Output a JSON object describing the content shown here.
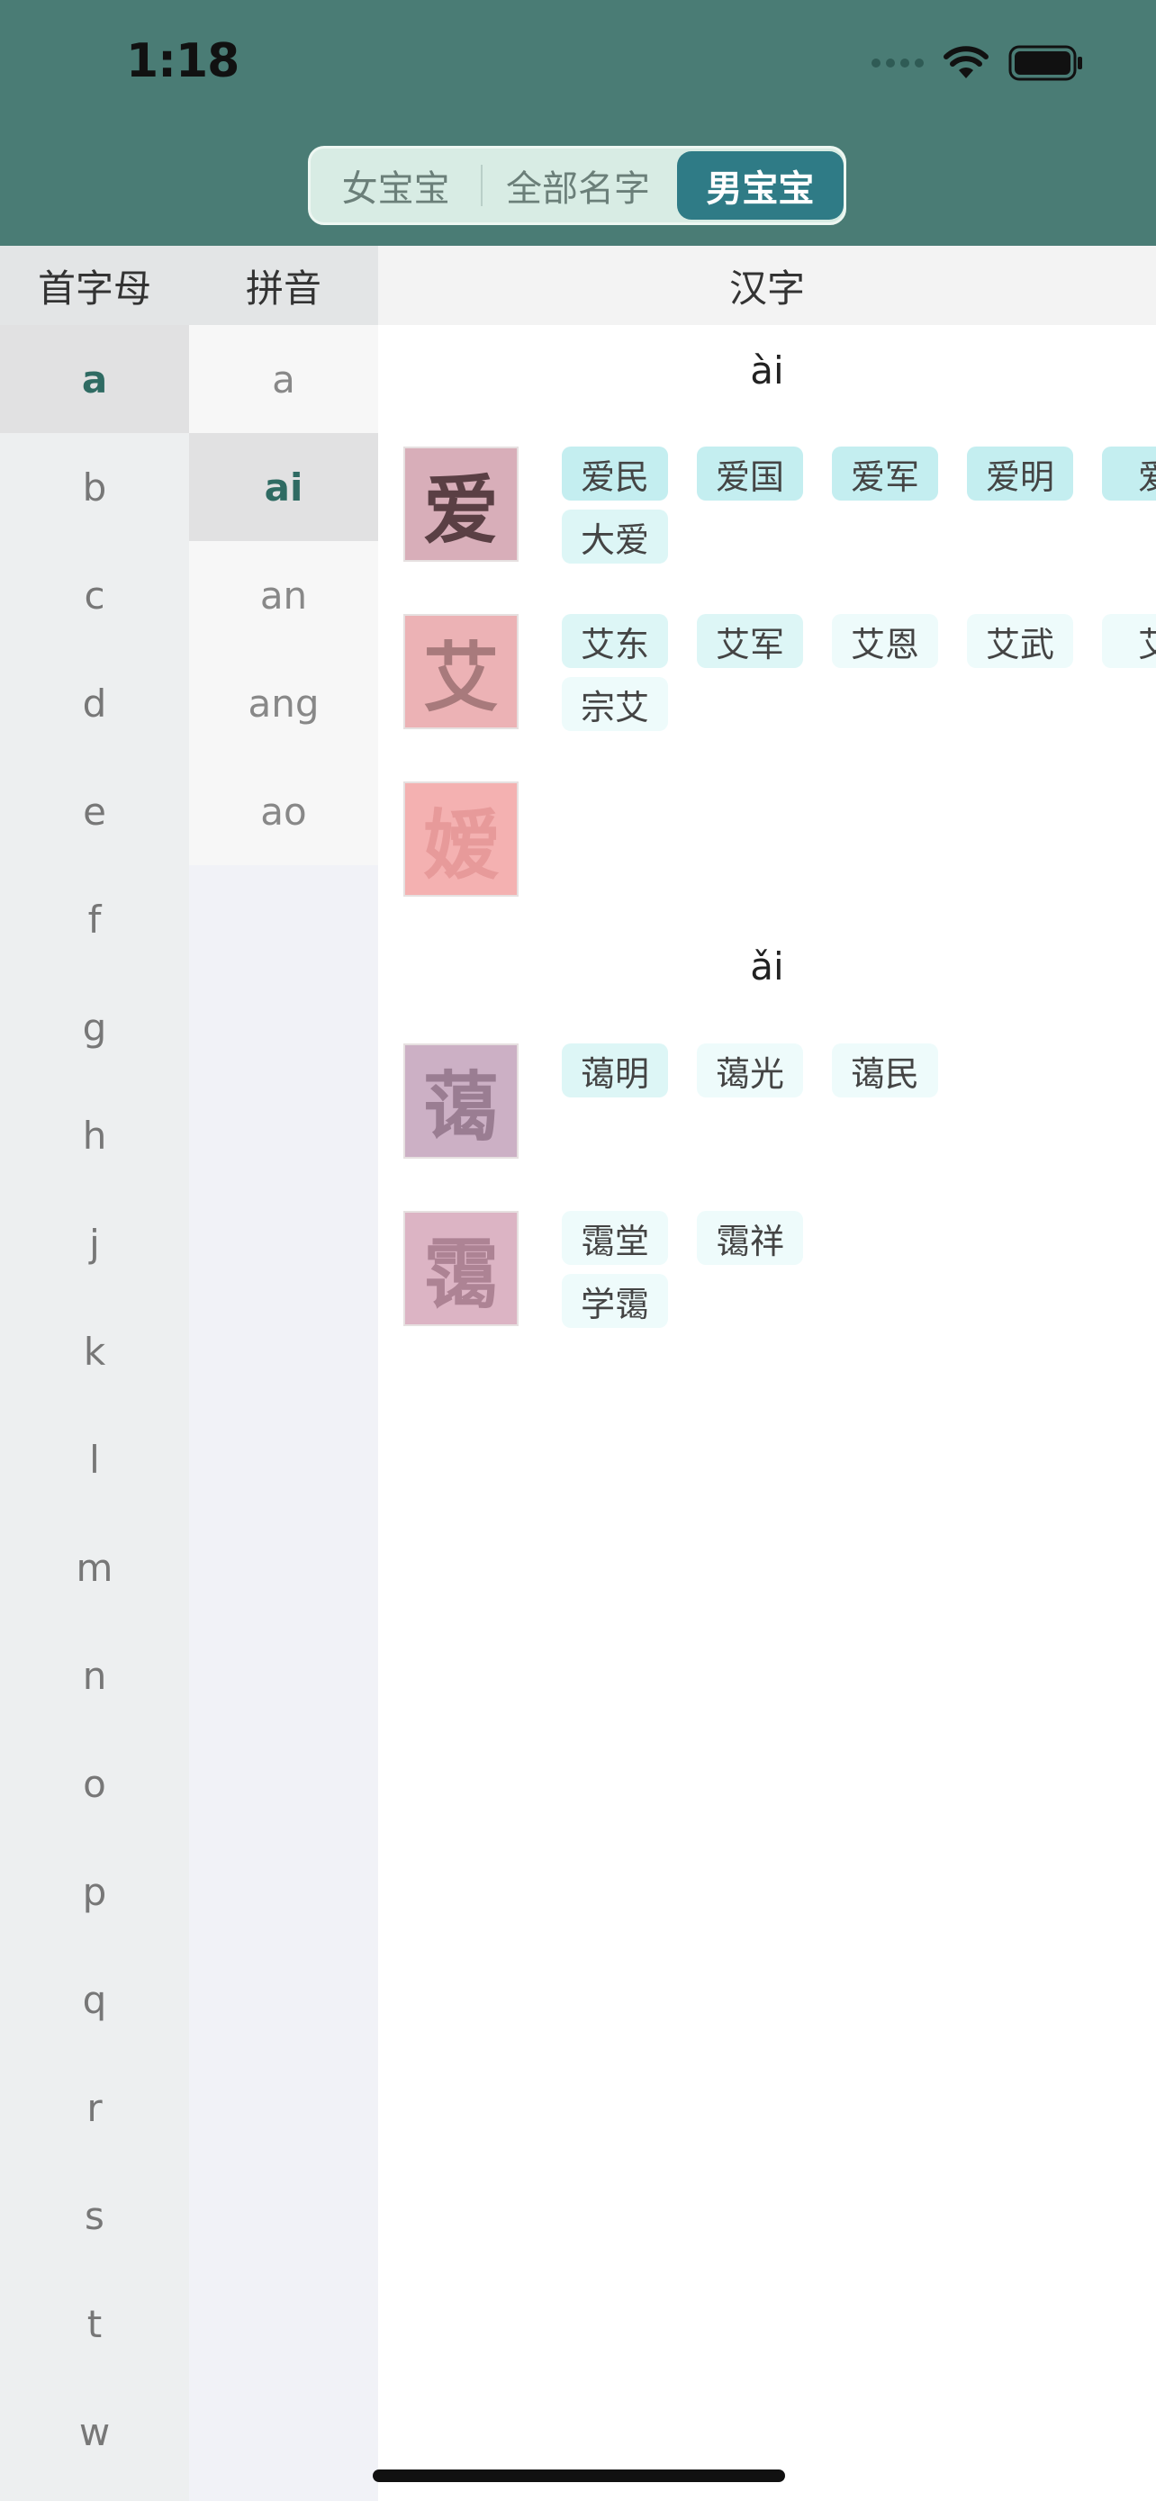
{
  "status": {
    "time": "1:18"
  },
  "segment": {
    "left": "女宝宝",
    "middle": "全部名字",
    "right": "男宝宝"
  },
  "columns": {
    "initial": "首字母",
    "pinyin": "拼音",
    "hanzi": "汉字"
  },
  "letters": [
    "a",
    "b",
    "c",
    "d",
    "e",
    "f",
    "g",
    "h",
    "j",
    "k",
    "l",
    "m",
    "n",
    "o",
    "p",
    "q",
    "r",
    "s",
    "t",
    "w"
  ],
  "pinyins": [
    "a",
    "ai",
    "an",
    "ang",
    "ao"
  ],
  "tones": [
    "ài",
    "ǎi"
  ],
  "chars": [
    {
      "char": "爱",
      "bg": "#d8aeb9",
      "fg": "#5a3f44",
      "names": [
        "爱民",
        "爱国",
        "爱军",
        "爱明",
        "爱",
        "大爱"
      ]
    },
    {
      "char": "艾",
      "bg": "#ecb2b5",
      "fg": "#a87a7c",
      "names": [
        "艾东",
        "艾军",
        "艾恩",
        "艾武",
        "艾",
        "宗艾"
      ]
    },
    {
      "char": "嫒",
      "bg": "#f4b1b1",
      "fg": "#e79a9a",
      "names": []
    },
    {
      "char": "蔼",
      "bg": "#ccb0c5",
      "fg": "#9a7d92",
      "names": [
        "蔼明",
        "蔼光",
        "蔼民"
      ]
    },
    {
      "char": "霭",
      "bg": "#dcb4c4",
      "fg": "#ad8394",
      "names": [
        "霭堂",
        "霭祥",
        "学霭"
      ]
    }
  ],
  "colors": {
    "header": "#4a7c75",
    "accent": "#2f7b86",
    "chip_strong": "#c4eef0",
    "chip_mid": "#ddf6f6",
    "chip_light": "#eefbfb"
  }
}
